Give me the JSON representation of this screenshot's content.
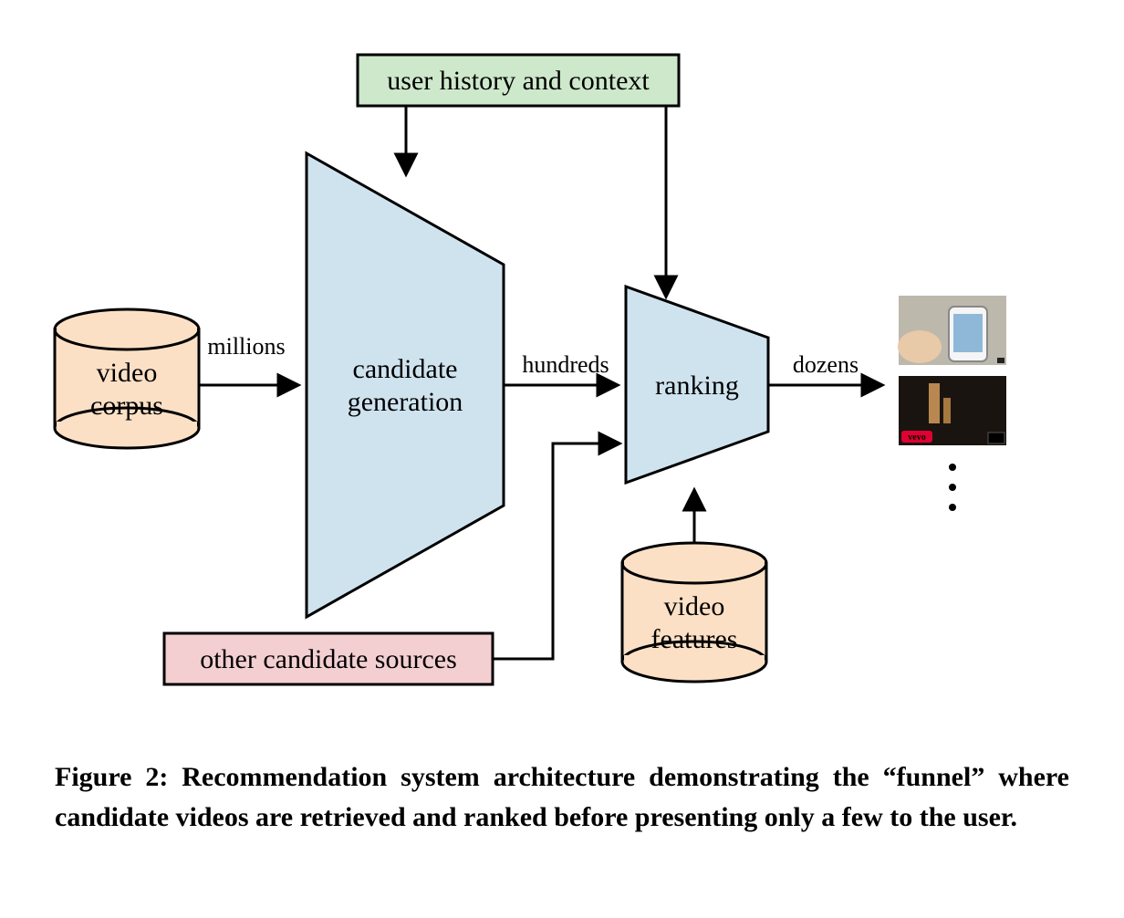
{
  "boxes": {
    "user_history": "user history and context",
    "video_corpus_l1": "video",
    "video_corpus_l2": "corpus",
    "candidate_gen_l1": "candidate",
    "candidate_gen_l2": "generation",
    "ranking": "ranking",
    "other_sources": "other candidate sources",
    "video_features_l1": "video",
    "video_features_l2": "features"
  },
  "edges": {
    "millions": "millions",
    "hundreds": "hundreds",
    "dozens": "dozens"
  },
  "thumbnails": {
    "vevo": "vevo"
  },
  "caption": "Figure 2:  Recommendation system architecture demonstrating the “funnel” where candidate videos are retrieved and ranked before presenting only a few to the user."
}
